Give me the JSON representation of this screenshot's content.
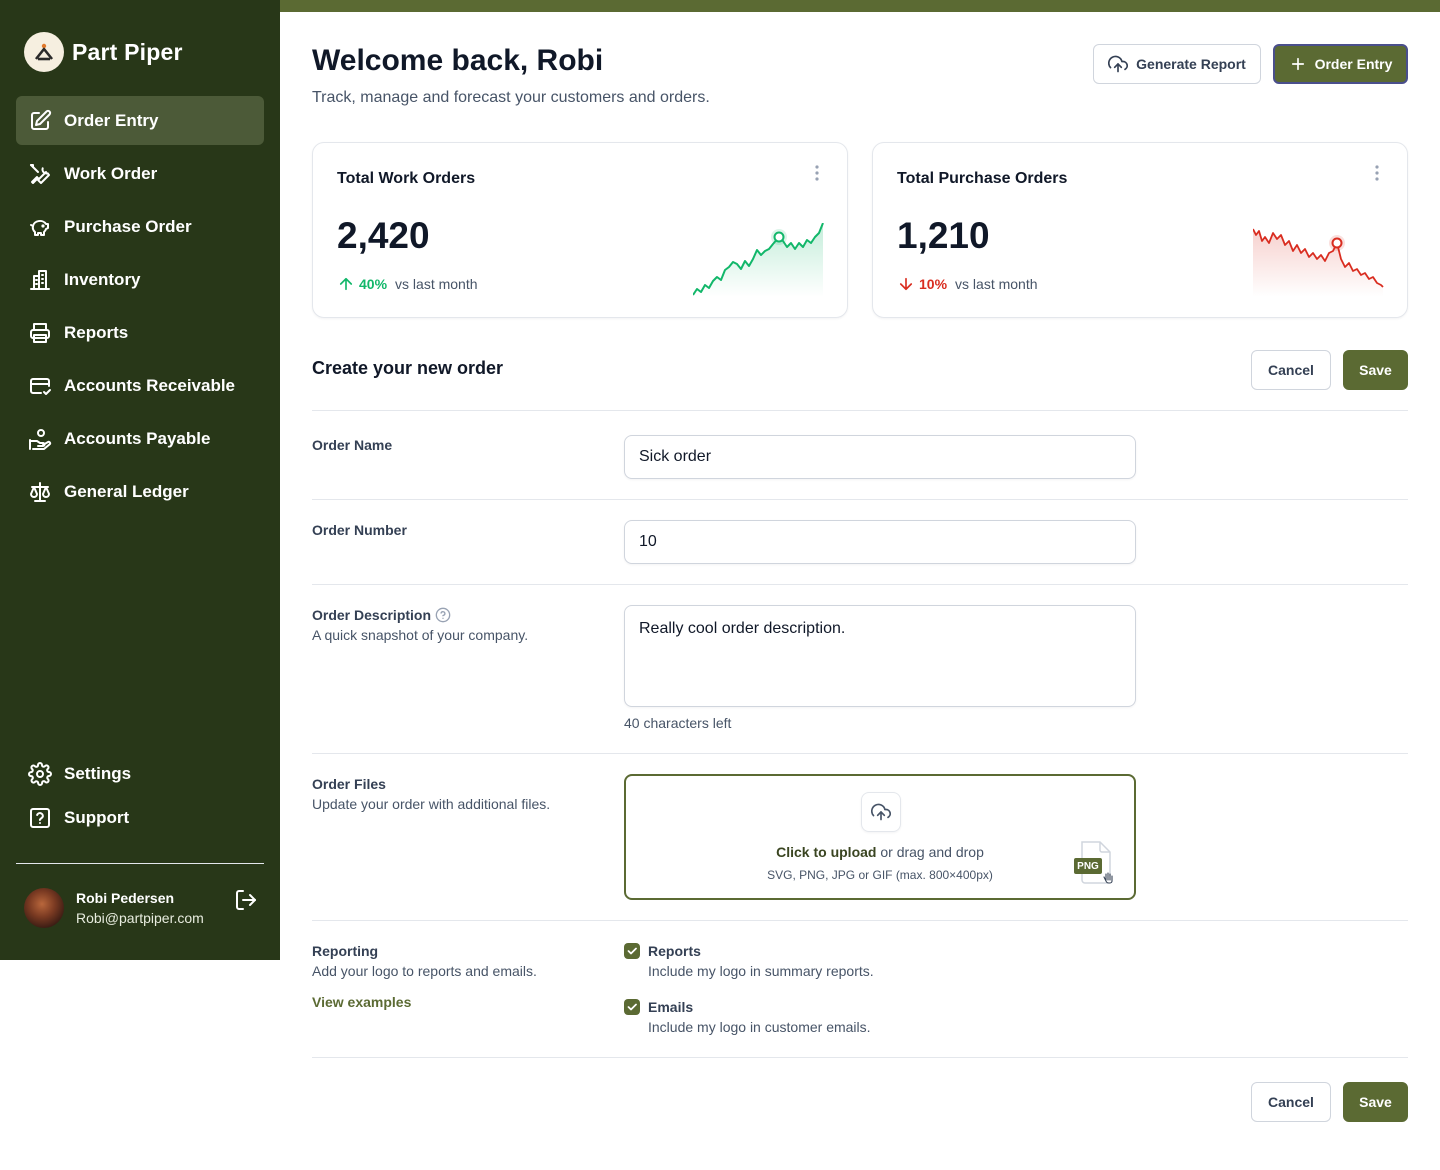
{
  "app": {
    "name": "Part Piper"
  },
  "sidebar": {
    "items": [
      {
        "label": "Order Entry",
        "icon": "edit-icon",
        "active": true
      },
      {
        "label": "Work Order",
        "icon": "tools-icon"
      },
      {
        "label": "Purchase Order",
        "icon": "piggy-bank-icon"
      },
      {
        "label": "Inventory",
        "icon": "building-icon"
      },
      {
        "label": "Reports",
        "icon": "printer-icon"
      },
      {
        "label": "Accounts Receivable",
        "icon": "credit-card-check-icon"
      },
      {
        "label": "Accounts Payable",
        "icon": "hand-coins-icon"
      },
      {
        "label": "General Ledger",
        "icon": "scales-icon"
      }
    ],
    "bottom_items": [
      {
        "label": "Settings",
        "icon": "gear-icon"
      },
      {
        "label": "Support",
        "icon": "help-square-icon"
      }
    ],
    "user": {
      "name": "Robi Pedersen",
      "email": "Robi@partpiper.com"
    }
  },
  "header": {
    "title": "Welcome back, Robi",
    "subtitle": "Track, manage and forecast your customers and orders.",
    "generate_report_label": "Generate Report",
    "order_entry_label": "Order Entry"
  },
  "stats": [
    {
      "title": "Total Work Orders",
      "value": "2,420",
      "trend": "40%",
      "trend_direction": "up",
      "trend_label": "vs last month",
      "color": "#12b76a"
    },
    {
      "title": "Total Purchase Orders",
      "value": "1,210",
      "trend": "10%",
      "trend_direction": "down",
      "trend_label": "vs last month",
      "color": "#d92d20"
    }
  ],
  "form": {
    "title": "Create your new order",
    "cancel_label": "Cancel",
    "save_label": "Save",
    "order_name": {
      "label": "Order Name",
      "value": "Sick order"
    },
    "order_number": {
      "label": "Order Number",
      "value": "10"
    },
    "order_description": {
      "label": "Order Description",
      "help": "A quick snapshot of your company.",
      "value": "Really cool order description.",
      "hint": "40 characters left"
    },
    "order_files": {
      "label": "Order Files",
      "help": "Update your order with additional files.",
      "upload_action": "Click to upload",
      "upload_rest": " or drag and drop",
      "upload_formats": "SVG, PNG, JPG or GIF (max. 800×400px)",
      "file_badge": "PNG"
    },
    "reporting": {
      "label": "Reporting",
      "help": "Add your logo to reports and emails.",
      "link": "View examples",
      "options": [
        {
          "title": "Reports",
          "desc": "Include my logo in summary reports.",
          "checked": true
        },
        {
          "title": "Emails",
          "desc": "Include my logo in customer emails.",
          "checked": true
        }
      ]
    }
  },
  "colors": {
    "sidebar_bg": "#283718",
    "accent": "#5b6a33",
    "up": "#12b76a",
    "down": "#d92d20"
  }
}
